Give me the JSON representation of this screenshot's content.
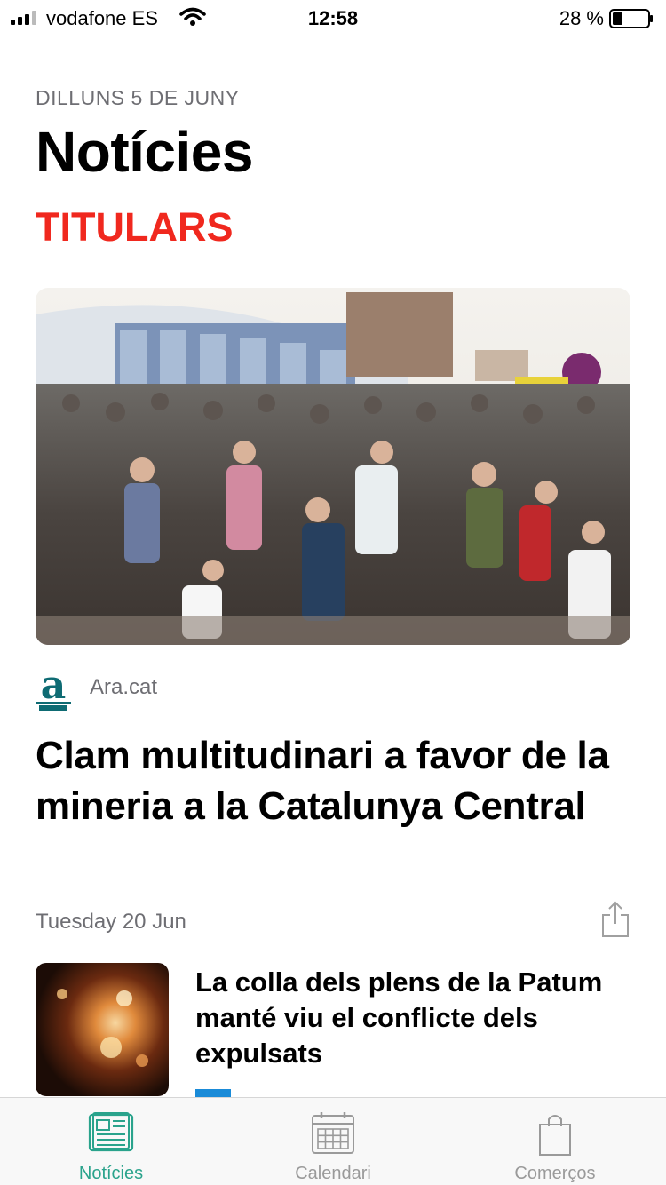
{
  "status_bar": {
    "carrier": "vodafone ES",
    "time": "12:58",
    "battery": "28 %"
  },
  "header": {
    "date": "DILLUNS 5 DE JUNY",
    "title": "Notícies",
    "section": "TITULARS"
  },
  "hero_article": {
    "source": "Ara.cat",
    "headline": "Clam multitudinari a favor de la mineria a la Catalunya Central",
    "date": "Tuesday 20 Jun"
  },
  "second_article": {
    "headline": "La colla dels plens de la Patum manté viu el conflicte dels expulsats"
  },
  "tab_bar": {
    "tabs": [
      {
        "label": "Notícies",
        "icon": "newspaper-icon",
        "active": true
      },
      {
        "label": "Calendari",
        "icon": "calendar-icon",
        "active": false
      },
      {
        "label": "Comerços",
        "icon": "shopping-bag-icon",
        "active": false
      }
    ]
  },
  "colors": {
    "accent_red": "#f0281e",
    "tab_active": "#2aa38c",
    "tab_inactive": "#9a9a9a",
    "secondary_text": "#6e6e73"
  }
}
